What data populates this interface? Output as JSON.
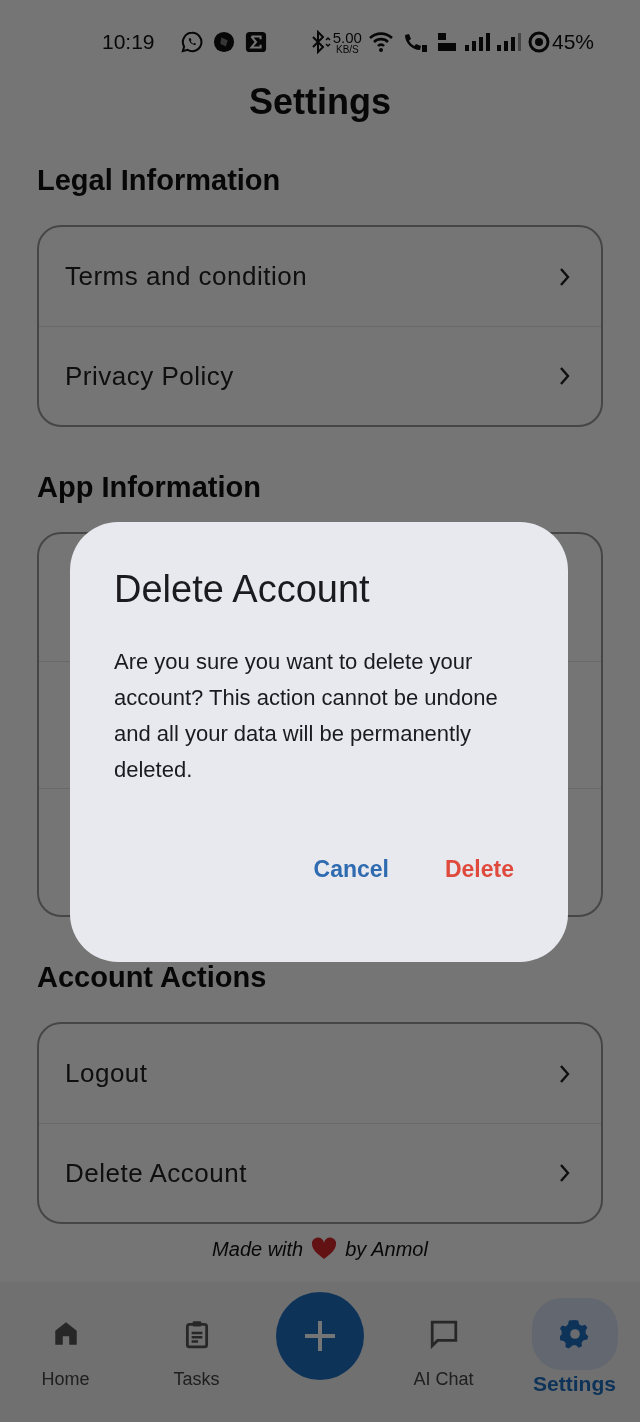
{
  "status_bar": {
    "time": "10:19",
    "speed": "5.00",
    "speed_unit": "KB/S",
    "battery": "45%"
  },
  "title": "Settings",
  "sections": [
    {
      "heading": "Legal Information",
      "rows": [
        {
          "label": "Terms and condition"
        },
        {
          "label": "Privacy Policy"
        }
      ]
    },
    {
      "heading": "App Information",
      "rows": [
        {},
        {},
        {}
      ]
    },
    {
      "heading": "Account Actions",
      "rows": [
        {
          "label": "Logout"
        },
        {
          "label": "Delete Account"
        }
      ]
    }
  ],
  "footer": {
    "before": "Made with",
    "after": "by Anmol"
  },
  "nav": [
    {
      "kind": "home",
      "label": "Home",
      "selected": false
    },
    {
      "kind": "tasks",
      "label": "Tasks",
      "selected": false
    },
    {
      "kind": "add"
    },
    {
      "kind": "chat",
      "label": "AI Chat",
      "selected": false
    },
    {
      "kind": "settings",
      "label": "Settings",
      "selected": true
    }
  ],
  "dialog": {
    "title": "Delete Account",
    "message": "Are you sure you want to delete your account? This action cannot be undone and all your data will be permanently deleted.",
    "actions": [
      {
        "kind": "cancel",
        "label": "Cancel"
      },
      {
        "kind": "destructive",
        "label": "Delete"
      }
    ]
  }
}
